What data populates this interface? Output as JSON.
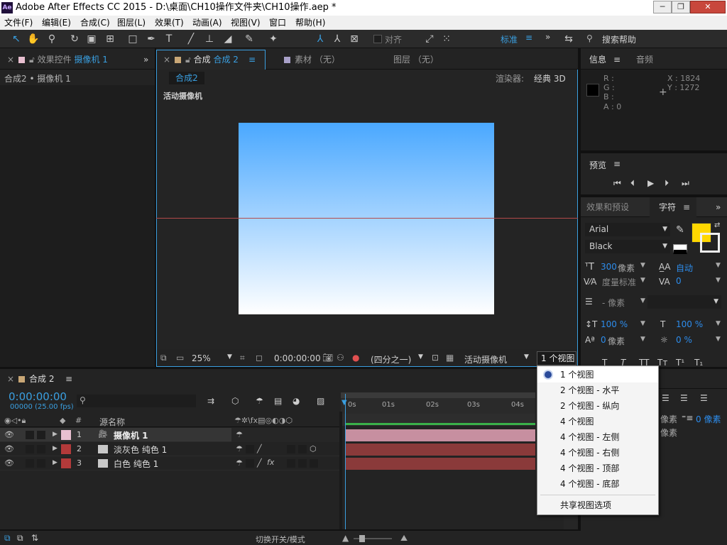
{
  "window": {
    "title": "Adobe After Effects CC 2015 - D:\\桌面\\CH10操作文件夹\\CH10操作.aep *",
    "logo": "Ae"
  },
  "menubar": [
    "文件(F)",
    "编辑(E)",
    "合成(C)",
    "图层(L)",
    "效果(T)",
    "动画(A)",
    "视图(V)",
    "窗口",
    "帮助(H)"
  ],
  "toolbar": {
    "snap_label": "对齐",
    "workspace": "标准",
    "search_label": "搜索帮助"
  },
  "left_panel": {
    "tab_label": "效果控件",
    "tab_target": "摄像机 1",
    "breadcrumb": "合成2 • 摄像机 1"
  },
  "viewer": {
    "tab_label": "合成",
    "tab_name": "合成 2",
    "footage_tab": "素材 （无）",
    "layer_tab": "图层 （无）",
    "comp_chip": "合成2",
    "renderer_label": "渲染器:",
    "renderer_value": "经典 3D",
    "view_name": "活动摄像机",
    "zoom": "25%",
    "timecode": "0:00:00:00",
    "resolution": "(四分之一)",
    "camera": "活动摄像机",
    "views": "1 个视图",
    "bg_top": "#4aa8ff",
    "bg_bottom": "#ffffff"
  },
  "info_panel": {
    "tab": "信息",
    "audio_tab": "音频",
    "r": "R :",
    "g": "G :",
    "b": "B :",
    "a": "A : 0",
    "x": "X : 1824",
    "y": "Y : 1272"
  },
  "preview_panel": {
    "tab": "预览"
  },
  "char_panel": {
    "effects_tab": "效果和预设",
    "tab": "字符",
    "font": "Arial",
    "style": "Black",
    "size": "300",
    "size_unit": "像素",
    "leading": "自动",
    "kerning": "度量标准",
    "tracking": "0",
    "stroke": "- 像素",
    "vscale": "100 %",
    "hscale": "100 %",
    "baseline": "0",
    "baseline_unit": "像素",
    "tsume": "0 %",
    "fill_color": "#ffd700",
    "para_value1": "像素",
    "para_value2": "0 像素",
    "para_value3": "像素"
  },
  "timeline": {
    "tab": "合成 2",
    "timecode": "0:00:00:00",
    "fps": "00000 (25.00 fps)",
    "col_source": "源名称",
    "col_num": "#",
    "layers": [
      {
        "num": "1",
        "name": "摄像机 1",
        "color": "#e8bfd0",
        "bar": "#c78fa0"
      },
      {
        "num": "2",
        "name": "淡灰色 纯色 1",
        "color": "#b23a3a",
        "bar": "#8a3a3a"
      },
      {
        "num": "3",
        "name": "白色 纯色 1",
        "color": "#b23a3a",
        "bar": "#8a3a3a"
      }
    ],
    "ruler": [
      "0s",
      "01s",
      "02s",
      "03s",
      "04s"
    ],
    "footer": "切换开关/模式"
  },
  "views_menu": {
    "items": [
      "1 个视图",
      "2 个视图 - 水平",
      "2 个视图 - 纵向",
      "4 个视图",
      "4 个视图 - 左侧",
      "4 个视图 - 右侧",
      "4 个视图 - 顶部",
      "4 个视图 - 底部"
    ],
    "shared": "共享视图选项",
    "selected_index": 0
  }
}
